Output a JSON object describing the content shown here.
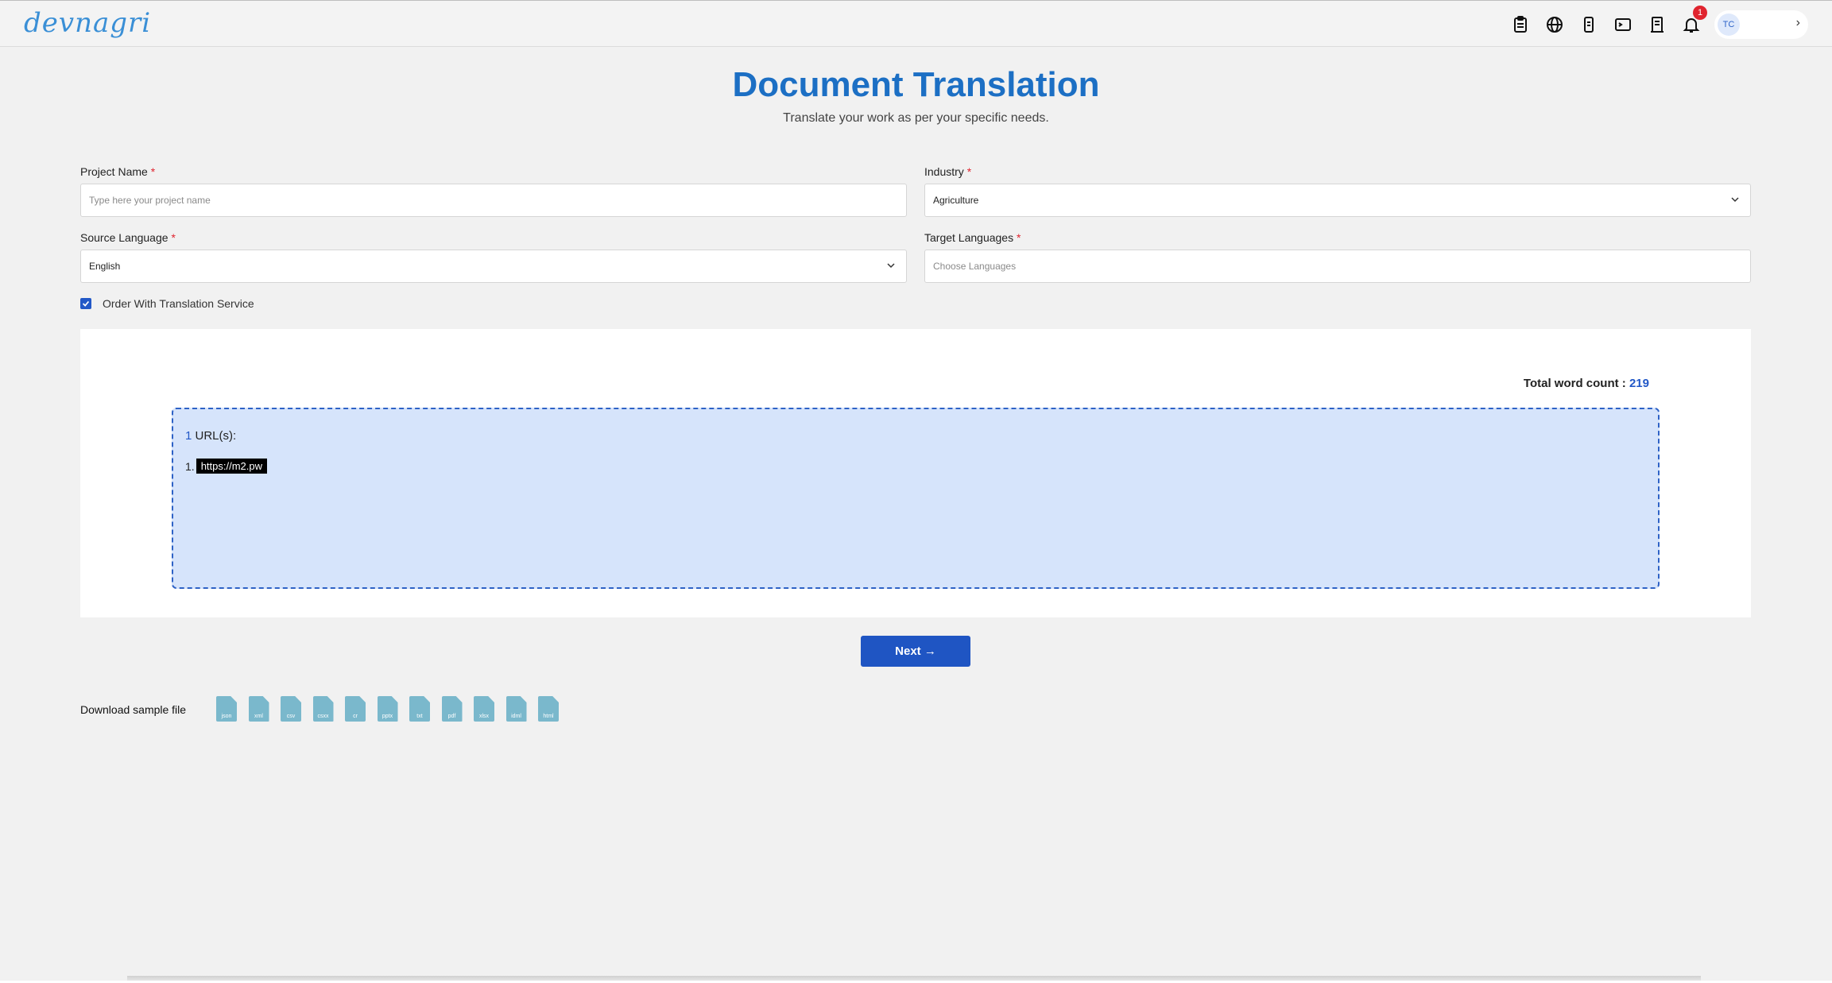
{
  "brand": {
    "logo_text": "devnagri"
  },
  "header": {
    "icons": [
      "clipboard-icon",
      "globe-icon",
      "mobile-icon",
      "terminal-icon",
      "document-icon",
      "bell-icon"
    ],
    "notification_count": "1",
    "avatar_initials": "TC"
  },
  "page": {
    "title": "Document Translation",
    "subtitle": "Translate your work as per your specific needs."
  },
  "form": {
    "project_name": {
      "label": "Project Name",
      "required": "*",
      "placeholder": "Type here your project name"
    },
    "industry": {
      "label": "Industry",
      "required": "*",
      "value": "Agriculture"
    },
    "source_language": {
      "label": "Source Language",
      "required": "*",
      "value": "English"
    },
    "target_languages": {
      "label": "Target Languages",
      "required": "*",
      "placeholder": "Choose Languages"
    },
    "order_service": {
      "label": "Order With Translation Service",
      "checked": true
    }
  },
  "upload": {
    "word_count_label": "Total word count :",
    "word_count": "219",
    "url_count": "1",
    "url_heading": "URL(s):",
    "urls": [
      {
        "index": "1.",
        "text": "https://m2.pw"
      }
    ]
  },
  "actions": {
    "next_label": "Next →"
  },
  "samples": {
    "label": "Download sample file",
    "files": [
      "json",
      "xml",
      "csv",
      "csxx",
      "cr",
      "pptx",
      "txt",
      "pdf",
      "xlsx",
      "idml",
      "html"
    ]
  },
  "colors": {
    "accent": "#1f55c3",
    "title": "#1c6fc4",
    "dropzone_bg": "#d6e4fb",
    "badge": "#e0242f"
  }
}
